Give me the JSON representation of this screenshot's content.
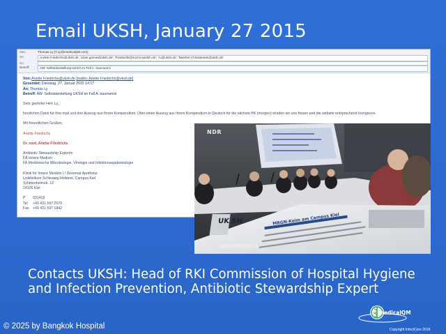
{
  "slide": {
    "title": "Email UKSH, January 27 2015",
    "caption_line1": "Contacts UKSH: Head of RKI Commission of Hospital Hygiene",
    "caption_line2": "and Infection Prevention, Antibiotic Stewardship Expert",
    "copyright": "© 2025 by Bangkok Hospital"
  },
  "email": {
    "header": {
      "von_label": "Von:",
      "von_value": "Thomas Ly [T.Ly@medicalQM.com]",
      "an_label": "An:",
      "an_value": "Anette.Friedrichs@uksh.de; 'oliver.grieve@uksh.de'; 'Poststelle@sozmi.landsh.de'; 'ru@uksh.de'; 'Baerbel.Christiansen@uksh.de'",
      "cc_label": "Cc:",
      "cc_value": "",
      "betreff_label": "Betreff:",
      "betreff_value": "AW: Selbstdarstellung UKSH im Fall A. baumannii"
    },
    "meta": {
      "von_label": "Von:",
      "von_name": "Anette Friedrichs@uksh.de",
      "von_mailto": "[mailto: Anette.Friedrichs@uksh.de]",
      "gesendet_label": "Gesendet:",
      "gesendet_value": "Dienstag, 27. Januar 2015 14:17",
      "an_label": "An:",
      "an_value": "Thomas Ly",
      "betreff_label": "Betreff:",
      "betreff_value": "AW: Selbstdarstellung UKSH im Fall A. baumannii"
    },
    "greeting": "Sehr geehrter Herr Ly,",
    "body": "herzlichen Dank für Ihre mail und den Auszug aus Ihrem Kompendium. Über einen Auszug aus Ihrem Kompendium in Deutsch für die nächste PK (morgen) würden wir uns freuen und die website entsprechend korrigieren.",
    "closing": "Mit freundlichen Grüßen,",
    "name": "Anette Friedrichs",
    "sig_name": "Dr. med. Anette Friedrichs",
    "sig_lines": [
      "Antibiotic Stewardship Expertin",
      "FÄ Innere Medizin",
      "FA Medizinische Mikrobiologie, Virologie und Infektionsepidemiologie"
    ],
    "address_lines": [
      "Klinik für Innere Medizin I / Dezernat Apotheke",
      "Uniklinikum Schleswig-Holstein, Campus Kiel",
      "Schittenhelmstr. 12",
      "24105 Kiel"
    ],
    "contacts": [
      {
        "k": "P",
        "v": "031418"
      },
      {
        "k": "Tel",
        "v": "+49 431 597 2579"
      },
      {
        "k": "Fax",
        "v": "+49 431 597 1842"
      }
    ]
  },
  "photo": {
    "broadcaster": "NDR",
    "ticker": "NDR//AKTUELL",
    "paper_masthead": "UK SH",
    "paper_headline": "MRGN-Keim am Campus Kiel"
  },
  "logo": {
    "text": "medicalQM",
    "copyright": "Copyright InfectCore 2018"
  }
}
